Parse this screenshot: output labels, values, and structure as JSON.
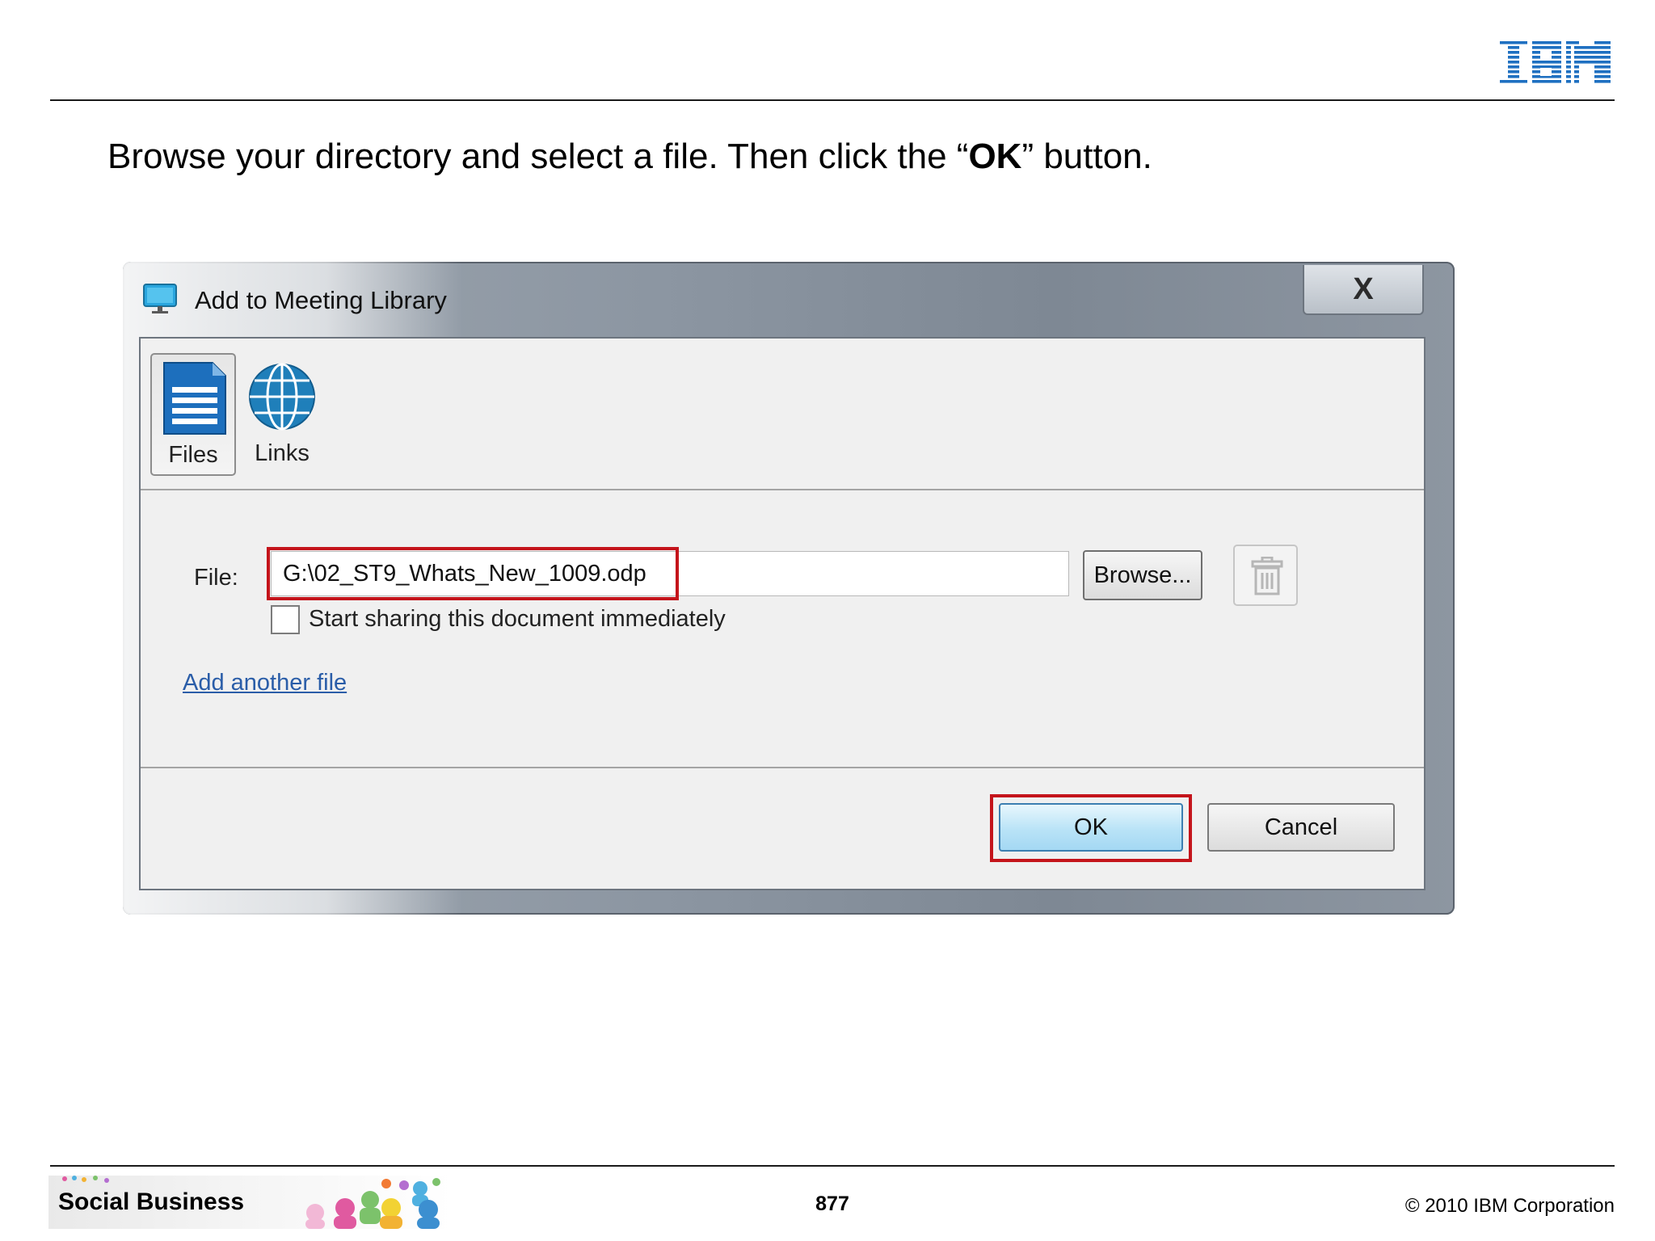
{
  "slide": {
    "instruction_before": "Browse your directory and select a file. Then click the “",
    "instruction_emphasis": "OK",
    "instruction_after": "” button.",
    "logo_text": "IBM",
    "footer_brand": "Social Business",
    "page_number": "877",
    "copyright": "© 2010 IBM Corporation"
  },
  "dialog": {
    "title": "Add to Meeting Library",
    "close_label": "X",
    "tabs": [
      {
        "label": "Files",
        "icon": "document-icon",
        "selected": true
      },
      {
        "label": "Links",
        "icon": "globe-icon",
        "selected": false
      }
    ],
    "file_label": "File:",
    "file_value": "G:\\02_ST9_Whats_New_1009.odp",
    "browse_label": "Browse...",
    "delete_icon": "trash-icon",
    "share_checkbox_label": "Start sharing this document immediately",
    "share_checked": false,
    "add_another_link": "Add another file",
    "ok_label": "OK",
    "cancel_label": "Cancel"
  },
  "colors": {
    "highlight": "#c4141b",
    "link": "#2a5da8",
    "ibm_blue": "#1f70c1",
    "ok_fill": "#b9e3f7"
  }
}
